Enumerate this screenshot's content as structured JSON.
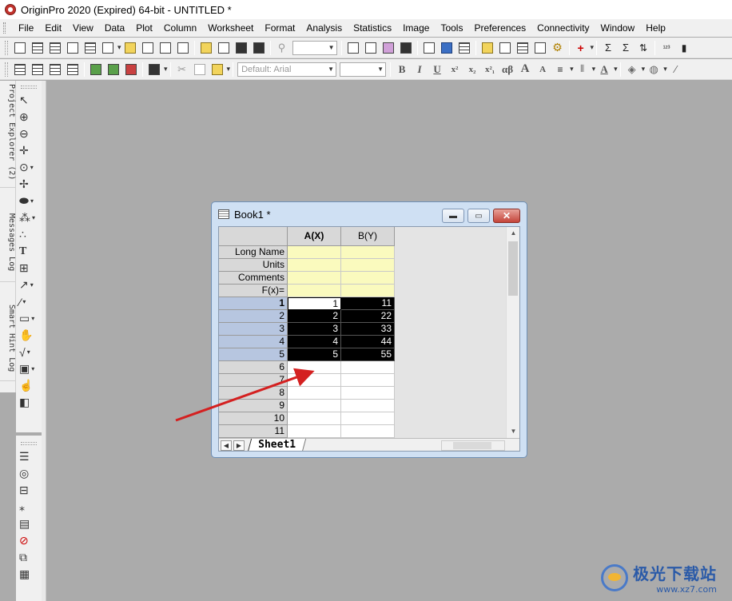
{
  "app": {
    "title": "OriginPro 2020 (Expired) 64-bit - UNTITLED *"
  },
  "menubar": {
    "items": [
      {
        "label": "File"
      },
      {
        "label": "Edit"
      },
      {
        "label": "View"
      },
      {
        "label": "Data"
      },
      {
        "label": "Plot"
      },
      {
        "label": "Column"
      },
      {
        "label": "Worksheet"
      },
      {
        "label": "Format"
      },
      {
        "label": "Analysis"
      },
      {
        "label": "Statistics"
      },
      {
        "label": "Image"
      },
      {
        "label": "Tools"
      },
      {
        "label": "Preferences"
      },
      {
        "label": "Connectivity"
      },
      {
        "label": "Window"
      },
      {
        "label": "Help"
      }
    ]
  },
  "toolbar2": {
    "font_placeholder": "Default: Arial",
    "bold": "B",
    "italic": "I",
    "underline": "U",
    "superscript": "x²",
    "subscript": "x₂",
    "supsub": "x²₁",
    "greek": "αβ",
    "grow_font": "A",
    "shrink_font": "A"
  },
  "dock_tabs": {
    "project_explorer": "Project Explorer (2)",
    "messages_log": "Messages Log",
    "smart_hint_log": "Smart Hint Log"
  },
  "workbook": {
    "title": "Book1 *",
    "columns": [
      "A(X)",
      "B(Y)"
    ],
    "meta_rows": [
      "Long Name",
      "Units",
      "Comments",
      "F(x)="
    ],
    "row_numbers": [
      "1",
      "2",
      "3",
      "4",
      "5",
      "6",
      "7",
      "8",
      "9",
      "10",
      "11"
    ],
    "data": [
      [
        "1",
        "11"
      ],
      [
        "2",
        "22"
      ],
      [
        "3",
        "33"
      ],
      [
        "4",
        "44"
      ],
      [
        "5",
        "55"
      ]
    ],
    "sheet_tab": "Sheet1"
  },
  "colors": {
    "selection": "#000000",
    "meta_fill": "#fafabe",
    "row_header_selected": "#b7c6e0",
    "annotation_arrow": "#d42020",
    "workspace": "#ababab"
  },
  "watermark": {
    "cn": "极光下载站",
    "url": "www.xz7.com"
  }
}
